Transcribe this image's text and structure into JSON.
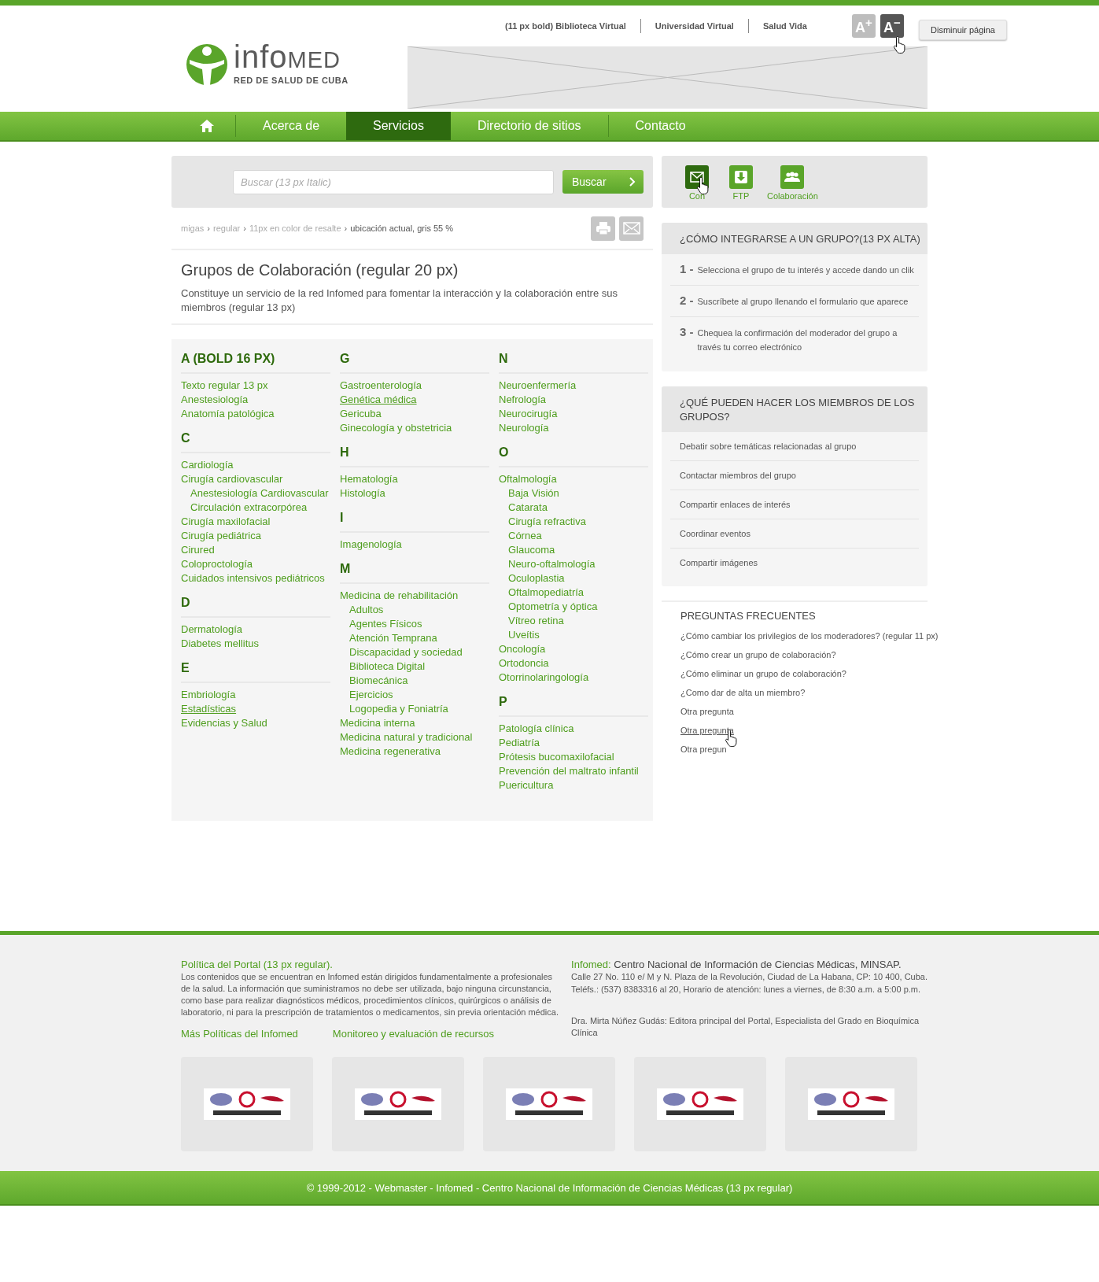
{
  "header": {
    "logo": {
      "name_start": "info",
      "name_end": "MED",
      "tagline": "RED DE SALUD DE CUBA"
    },
    "top_links": [
      "(11 px bold) Biblioteca Virtual",
      "Universidad Virtual",
      "Salud Vida"
    ],
    "font_buttons": [
      {
        "label": "A$^{+}$",
        "selected": false
      },
      {
        "label": "A$^{−}$",
        "selected": true
      }
    ],
    "tooltip": "Disminuir página"
  },
  "nav": [
    {
      "kind": "home",
      "selected": false
    },
    {
      "kind": "text",
      "label": "Acerca de",
      "selected": false
    },
    {
      "kind": "text",
      "label": "Servicios",
      "selected": true
    },
    {
      "kind": "text",
      "label": "Directorio de sitios",
      "selected": false
    },
    {
      "kind": "text",
      "label": "Contacto",
      "selected": false
    }
  ],
  "search": {
    "placeholder": "Buscar (13 px Italic)",
    "button": "Buscar"
  },
  "breadcrumb": {
    "separator": "›",
    "items": [
      {
        "text": "migas",
        "current": false
      },
      {
        "text": "regular",
        "current": false
      },
      {
        "text": "11px en color de resalte",
        "current": false
      },
      {
        "text": "ubicación actual, gris 55 %",
        "current": true
      }
    ]
  },
  "page": {
    "title": "Grupos de Colaboración (regular 20 px)",
    "description": "Constituye un servicio de la red Infomed para fomentar la interacción y la colaboración entre sus miembros (regular 13 px)"
  },
  "index_columns": [
    [
      {
        "letter": "A (BOLD 16 PX)",
        "items": [
          {
            "text": "Texto regular 13 px",
            "underlined": false
          },
          {
            "text": "Anestesiología",
            "underlined": false
          },
          {
            "text": "Anatomía patológica",
            "underlined": false
          }
        ]
      },
      {
        "letter": "C",
        "items": [
          {
            "text": "Cardiología",
            "underlined": false
          },
          {
            "text": "Cirugía cardiovascular",
            "underlined": false,
            "children": [
              {
                "text": "Anestesiología Cardiovascular",
                "underlined": false
              },
              {
                "text": "Circulación extracorpórea",
                "underlined": false
              }
            ]
          },
          {
            "text": "Cirugía maxilofacial",
            "underlined": false
          },
          {
            "text": "Cirugía pediátrica",
            "underlined": false
          },
          {
            "text": "Cirured",
            "underlined": false
          },
          {
            "text": "Coloproctología",
            "underlined": false
          },
          {
            "text": "Cuidados intensivos pediátricos",
            "underlined": false
          }
        ]
      },
      {
        "letter": "D",
        "items": [
          {
            "text": "Dermatología",
            "underlined": false
          },
          {
            "text": "Diabetes mellitus",
            "underlined": false
          }
        ]
      },
      {
        "letter": "E",
        "items": [
          {
            "text": "Embriología",
            "underlined": false
          },
          {
            "text": "Estadísticas",
            "underlined": true
          },
          {
            "text": "Evidencias y Salud",
            "underlined": false
          }
        ]
      }
    ],
    [
      {
        "letter": "G",
        "items": [
          {
            "text": "Gastroenterología",
            "underlined": false
          },
          {
            "text": "Genética médica",
            "underlined": true
          },
          {
            "text": "Gericuba",
            "underlined": false
          },
          {
            "text": "Ginecología y obstetricia",
            "underlined": false
          }
        ]
      },
      {
        "letter": "H",
        "items": [
          {
            "text": "Hematología",
            "underlined": false
          },
          {
            "text": "Histología",
            "underlined": false
          }
        ]
      },
      {
        "letter": "I",
        "items": [
          {
            "text": "Imagenología",
            "underlined": false
          }
        ]
      },
      {
        "letter": "M",
        "items": [
          {
            "text": "Medicina de rehabilitación",
            "underlined": false,
            "children": [
              {
                "text": "Adultos",
                "underlined": false
              },
              {
                "text": "Agentes Físicos",
                "underlined": false
              },
              {
                "text": "Atención Temprana",
                "underlined": false
              },
              {
                "text": "Discapacidad y sociedad",
                "underlined": false
              },
              {
                "text": "Biblioteca Digital",
                "underlined": false
              },
              {
                "text": "Biomecánica",
                "underlined": false
              },
              {
                "text": "Ejercicios",
                "underlined": false
              },
              {
                "text": "Logopedia y Foniatría",
                "underlined": false
              }
            ]
          },
          {
            "text": "Medicina interna",
            "underlined": false
          },
          {
            "text": "Medicina natural y tradicional",
            "underlined": false
          },
          {
            "text": "Medicina regenerativa",
            "underlined": false
          }
        ]
      }
    ],
    [
      {
        "letter": "N",
        "items": [
          {
            "text": "Neuroenfermería",
            "underlined": false
          },
          {
            "text": "Nefrología",
            "underlined": false
          },
          {
            "text": "Neurocirugía",
            "underlined": false
          },
          {
            "text": "Neurología",
            "underlined": false
          }
        ]
      },
      {
        "letter": "O",
        "items": [
          {
            "text": "Oftalmología",
            "underlined": false,
            "children": [
              {
                "text": "Baja Visión",
                "underlined": false
              },
              {
                "text": "Catarata",
                "underlined": false
              },
              {
                "text": "Cirugía refractiva",
                "underlined": false
              },
              {
                "text": "Córnea",
                "underlined": false
              },
              {
                "text": "Glaucoma",
                "underlined": false
              },
              {
                "text": "Neuro-oftalmología",
                "underlined": false
              },
              {
                "text": "Oculoplastia",
                "underlined": false
              },
              {
                "text": "Oftalmopediatría",
                "underlined": false
              },
              {
                "text": "Optometría y óptica",
                "underlined": false
              },
              {
                "text": "Vítreo retina",
                "underlined": false
              },
              {
                "text": "Uveítis",
                "underlined": false
              }
            ]
          },
          {
            "text": "Oncología",
            "underlined": false
          },
          {
            "text": "Ortodoncia",
            "underlined": false
          },
          {
            "text": "Otorrinolaringología",
            "underlined": false
          }
        ]
      },
      {
        "letter": "P",
        "items": [
          {
            "text": "Patología clínica",
            "underlined": false
          },
          {
            "text": "Pediatría",
            "underlined": false
          },
          {
            "text": "Prótesis bucomaxilofacial",
            "underlined": false
          },
          {
            "text": "Prevención del maltrato infantil",
            "underlined": false
          },
          {
            "text": "Puericultura",
            "underlined": false
          }
        ]
      }
    ]
  ],
  "tools": [
    {
      "kind": "mail",
      "label": "Con",
      "selected": true
    },
    {
      "kind": "download",
      "label": "FTP",
      "selected": false
    },
    {
      "kind": "group",
      "label": "Colaboración",
      "selected": false
    }
  ],
  "steps_card": {
    "title": "¿CÓMO INTEGRARSE A UN GRUPO?(13 PX ALTA)",
    "steps": [
      {
        "number": "1 -",
        "text": "Selecciona el grupo de tu interés y accede dando un clik"
      },
      {
        "number": "2 -",
        "text": "Suscríbete al grupo llenando el formulario que aparece"
      },
      {
        "number": "3 -",
        "text": "Chequea la confirmación del moderador del grupo a través tu correo electrónico"
      }
    ]
  },
  "members_card": {
    "title": "¿QUÉ PUEDEN HACER LOS MIEMBROS DE LOS GRUPOS?",
    "items": [
      "Debatir sobre temáticas relacionadas al grupo",
      "Contactar miembros del grupo",
      "Compartir enlaces de interés",
      "Coordinar eventos",
      "Compartir imágenes"
    ]
  },
  "faq": {
    "title": "PREGUNTAS FRECUENTES",
    "items": [
      {
        "text": "¿Cómo cambiar los privilegios de los moderadores? (regular 11 px)",
        "underlined": false,
        "pointer": false
      },
      {
        "text": "¿Cómo crear un grupo de colaboración?",
        "underlined": false,
        "pointer": false
      },
      {
        "text": "¿Cómo eliminar un grupo de colaboración?",
        "underlined": false,
        "pointer": false
      },
      {
        "text": "¿Como dar de alta un miembro?",
        "underlined": false,
        "pointer": false
      },
      {
        "text": "Otra pregunta",
        "underlined": false,
        "pointer": false
      },
      {
        "text": "Otra pregunta",
        "underlined": true,
        "pointer": true
      },
      {
        "text": "Otra pregun",
        "underlined": false,
        "pointer": false
      }
    ]
  },
  "footer": {
    "policy_title": "Política del Portal (13 px regular).",
    "policy_text": "Los contenidos que se encuentran en Infomed están dirigidos fundamentalmente a profesionales de la salud. La información que suministramos no debe ser utilizada, bajo ninguna circunstancia, como base para realizar diagnósticos médicos, procedimientos clínicos, quirúrgicos o análisis de laboratorio, ni para la prescripción de tratamientos o medicamentos, sin previa orientación médica.",
    "links": [
      "Más Políticas del Infomed",
      "Monitoreo y evaluación de recursos"
    ],
    "org_label": "Infomed:",
    "org_name": "Centro Nacional de Información de Ciencias Médicas, MINSAP.",
    "address": [
      "Calle 27 No. 110 e/ M y N. Plaza de la Revolución, Ciudad de La Habana, CP: 10 400, Cuba.",
      "Teléfs.: (537) 8383316 al 20, Horario de atención: lunes a viernes, de 8:30 a.m. a 5:00 p.m."
    ],
    "editor": "Dra. Mirta Núñez Gudás: Editora principal del Portal, Especialista del Grado en Bioquímica Clínica",
    "badges": [
      {
        "kind": "picture"
      },
      {
        "kind": "picture"
      },
      {
        "kind": "picture"
      },
      {
        "kind": "picture"
      },
      {
        "kind": "picture"
      }
    ],
    "copyright": "© 1999-2012 - Webmaster - Infomed - Centro Nacional de Información de Ciencias Médicas (13 px regular)"
  }
}
